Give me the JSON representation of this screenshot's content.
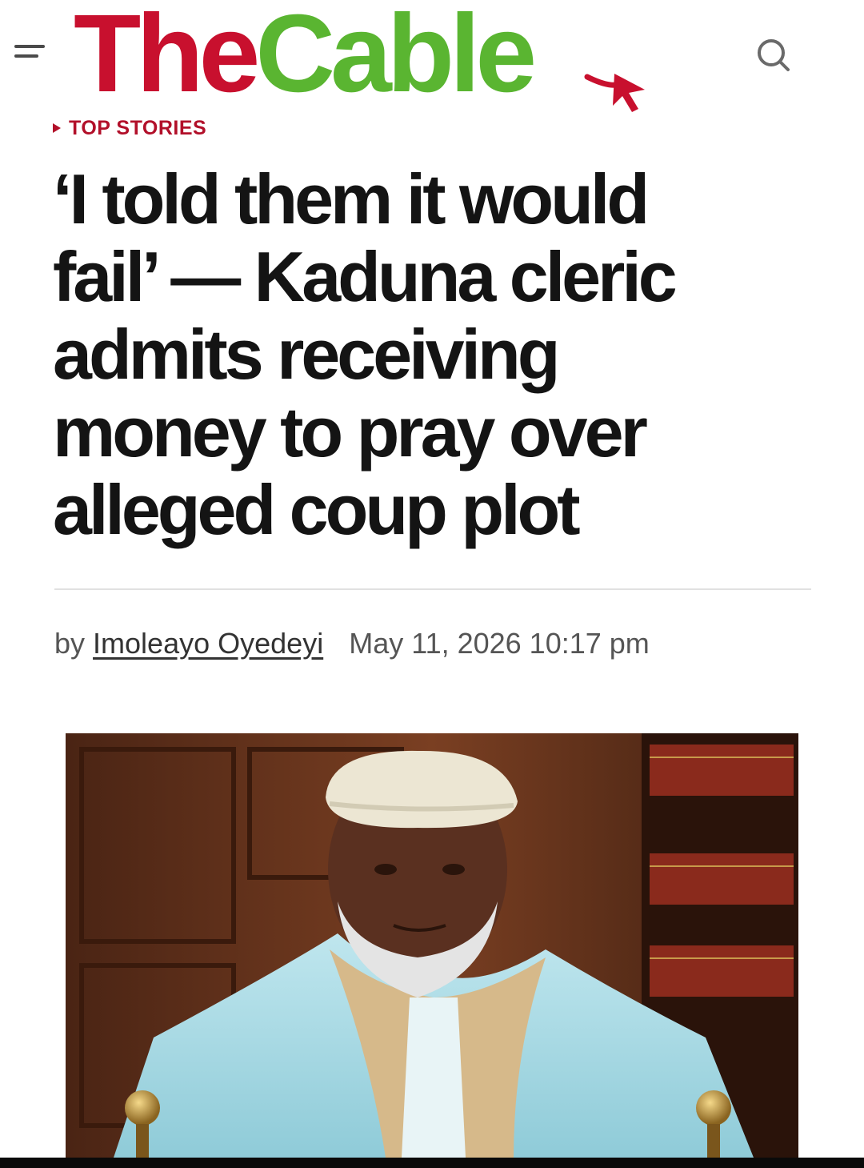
{
  "header": {
    "logo_the": "The",
    "logo_cable": "Cable",
    "menu_icon": "hamburger-icon",
    "search_icon": "search-icon"
  },
  "article": {
    "section": "TOP STORIES",
    "headline_lines": [
      "‘I told them it would",
      "fail’ — Kaduna cleric",
      "admits receiving",
      "money to pray over",
      "alleged coup plot"
    ],
    "byline_prefix": "by",
    "author": "Imoleayo Oyedeyi",
    "date": "May 11, 2026 10:17 pm"
  },
  "colors": {
    "brand_red": "#c8102e",
    "brand_green": "#5ab531",
    "section_red": "#b2102a"
  }
}
